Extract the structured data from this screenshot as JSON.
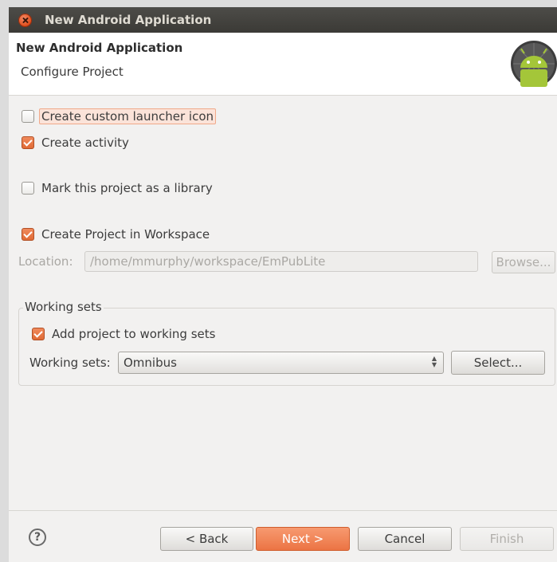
{
  "window": {
    "title": "New Android Application"
  },
  "header": {
    "title": "New Android Application",
    "subtitle": "Configure Project",
    "logo_icon": "android-logo-icon"
  },
  "options": {
    "custom_launcher_icon": {
      "label": "Create custom launcher icon",
      "checked": false
    },
    "create_activity": {
      "label": "Create activity",
      "checked": true
    },
    "mark_library": {
      "label": "Mark this project as a library",
      "checked": false
    },
    "create_in_workspace": {
      "label": "Create Project in Workspace",
      "checked": true
    }
  },
  "location": {
    "label": "Location:",
    "value": "/home/mmurphy/workspace/EmPubLite",
    "browse_label": "Browse..."
  },
  "working_sets": {
    "group_title": "Working sets",
    "add_label": "Add project to working sets",
    "add_checked": true,
    "field_label": "Working sets:",
    "selected": "Omnibus",
    "select_label": "Select..."
  },
  "footer": {
    "help_icon": "?",
    "back_label": "< Back",
    "next_label": "Next >",
    "cancel_label": "Cancel",
    "finish_label": "Finish"
  },
  "colors": {
    "accent": "#e06a35",
    "titlebar": "#3b3a36",
    "android_green": "#a4c639"
  }
}
